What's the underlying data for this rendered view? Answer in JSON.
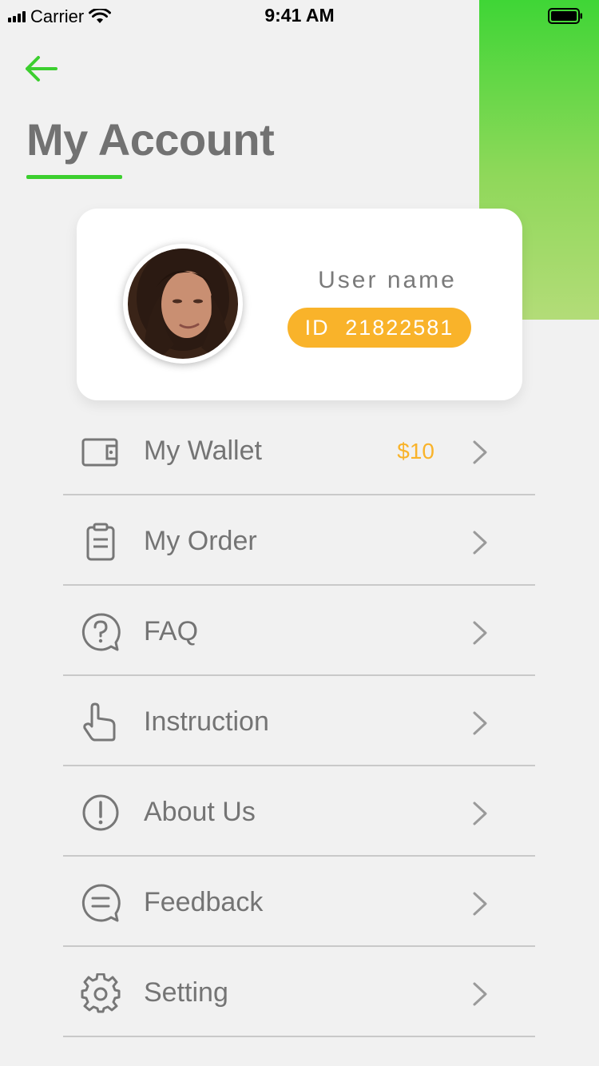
{
  "status_bar": {
    "carrier": "Carrier",
    "time": "9:41 AM"
  },
  "header": {
    "title": "My Account"
  },
  "profile": {
    "username": "User name",
    "id_label": "ID",
    "id_value": "21822581"
  },
  "menu": [
    {
      "label": "My Wallet",
      "value": "$10",
      "icon": "wallet-icon"
    },
    {
      "label": "My Order",
      "icon": "clipboard-icon"
    },
    {
      "label": "FAQ",
      "icon": "question-bubble-icon"
    },
    {
      "label": "Instruction",
      "icon": "hand-pointer-icon"
    },
    {
      "label": "About Us",
      "icon": "info-circle-icon"
    },
    {
      "label": "Feedback",
      "icon": "chat-bubble-icon"
    },
    {
      "label": "Setting",
      "icon": "gear-icon"
    }
  ],
  "colors": {
    "accent_green": "#3ccf2f",
    "badge_orange": "#f9b32a",
    "text_gray": "#747474"
  }
}
